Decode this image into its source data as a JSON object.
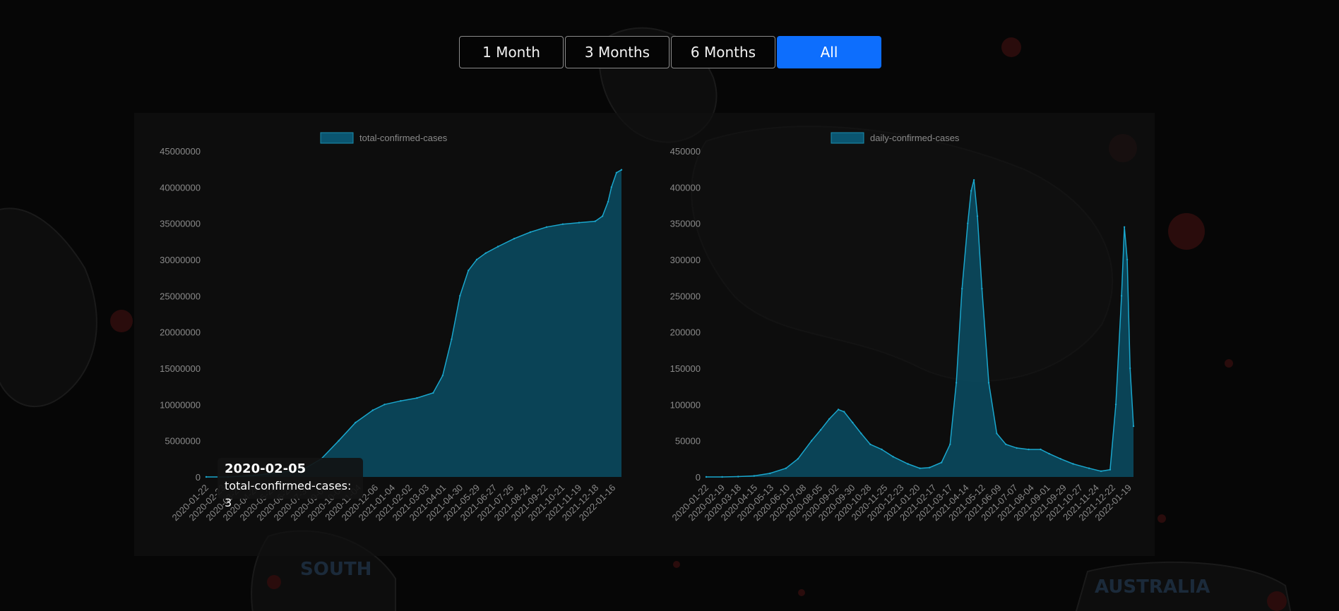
{
  "range_buttons": [
    {
      "label": "1 Month",
      "active": false
    },
    {
      "label": "3 Months",
      "active": false
    },
    {
      "label": "6 Months",
      "active": false
    },
    {
      "label": "All",
      "active": true
    }
  ],
  "colors": {
    "accent": "#0d6efd",
    "series_fill": "#0a4d64",
    "series_line": "#1aa6cc",
    "legend_box": "#0a5570"
  },
  "tooltip": {
    "title": "2020-02-05",
    "body": "total-confirmed-cases: 3"
  },
  "chart_data": [
    {
      "type": "area",
      "title": "",
      "series": [
        {
          "name": "total-confirmed-cases"
        }
      ],
      "legend": "top",
      "ylim": [
        0,
        45000000
      ],
      "ytick_labels": [
        "0",
        "5000000",
        "10000000",
        "15000000",
        "20000000",
        "25000000",
        "30000000",
        "35000000",
        "40000000",
        "45000000"
      ],
      "xtick_labels": [
        "2020-01-22",
        "2020-02-23",
        "2020-03-25",
        "2020-04-26",
        "2020-05-28",
        "2020-06-29",
        "2020-07-31",
        "2020-09-01",
        "2020-10-03",
        "2020-11-04",
        "2020-12-06",
        "2021-01-04",
        "2021-02-02",
        "2021-03-03",
        "2021-04-01",
        "2021-04-30",
        "2021-05-29",
        "2021-06-27",
        "2021-07-26",
        "2021-08-24",
        "2021-09-22",
        "2021-10-21",
        "2021-11-19",
        "2021-12-18",
        "2022-01-16"
      ],
      "x": [
        "2020-01-22",
        "2020-03-01",
        "2020-04-15",
        "2020-06-01",
        "2020-07-15",
        "2020-08-15",
        "2020-09-15",
        "2020-10-15",
        "2020-11-15",
        "2020-12-06",
        "2021-01-04",
        "2021-02-02",
        "2021-03-03",
        "2021-03-20",
        "2021-04-05",
        "2021-04-20",
        "2021-05-05",
        "2021-05-20",
        "2021-06-05",
        "2021-06-27",
        "2021-07-26",
        "2021-08-24",
        "2021-09-22",
        "2021-10-21",
        "2021-11-19",
        "2021-12-18",
        "2021-12-31",
        "2022-01-10",
        "2022-01-16",
        "2022-01-25",
        "2022-02-03"
      ],
      "values": [
        0,
        3000,
        200000,
        600000,
        1100000,
        2500000,
        5000000,
        7500000,
        9200000,
        10000000,
        10500000,
        10900000,
        11600000,
        14000000,
        19000000,
        25000000,
        28500000,
        30000000,
        30900000,
        31800000,
        32900000,
        33800000,
        34500000,
        34900000,
        35100000,
        35300000,
        36000000,
        38000000,
        40000000,
        42000000,
        42400000
      ]
    },
    {
      "type": "area",
      "title": "",
      "series": [
        {
          "name": "daily-confirmed-cases"
        }
      ],
      "legend": "top",
      "ylim": [
        0,
        450000
      ],
      "ytick_labels": [
        "0",
        "50000",
        "100000",
        "150000",
        "200000",
        "250000",
        "300000",
        "350000",
        "400000",
        "450000"
      ],
      "xtick_labels": [
        "2020-01-22",
        "2020-02-19",
        "2020-03-18",
        "2020-04-15",
        "2020-05-13",
        "2020-06-10",
        "2020-07-08",
        "2020-08-05",
        "2020-09-02",
        "2020-09-30",
        "2020-10-28",
        "2020-11-25",
        "2020-12-23",
        "2021-01-20",
        "2021-02-17",
        "2021-03-17",
        "2021-04-14",
        "2021-05-12",
        "2021-06-09",
        "2021-07-07",
        "2021-08-04",
        "2021-09-01",
        "2021-09-29",
        "2021-10-27",
        "2021-11-24",
        "2021-12-22",
        "2022-01-19"
      ],
      "x": [
        "2020-01-22",
        "2020-02-19",
        "2020-03-18",
        "2020-04-15",
        "2020-05-13",
        "2020-06-10",
        "2020-07-01",
        "2020-07-25",
        "2020-08-10",
        "2020-08-25",
        "2020-09-10",
        "2020-09-20",
        "2020-10-05",
        "2020-10-20",
        "2020-11-05",
        "2020-11-25",
        "2020-12-15",
        "2021-01-10",
        "2021-01-31",
        "2021-02-17",
        "2021-03-10",
        "2021-03-25",
        "2021-04-05",
        "2021-04-15",
        "2021-04-25",
        "2021-05-01",
        "2021-05-06",
        "2021-05-12",
        "2021-05-20",
        "2021-06-01",
        "2021-06-15",
        "2021-07-01",
        "2021-07-20",
        "2021-08-10",
        "2021-08-31",
        "2021-09-15",
        "2021-10-05",
        "2021-10-27",
        "2021-11-24",
        "2021-12-15",
        "2021-12-31",
        "2022-01-10",
        "2022-01-20",
        "2022-01-25",
        "2022-01-30",
        "2022-02-04",
        "2022-02-10"
      ],
      "values": [
        0,
        0,
        500,
        1500,
        5000,
        12000,
        25000,
        50000,
        65000,
        80000,
        93000,
        90000,
        75000,
        60000,
        45000,
        38000,
        28000,
        18000,
        12000,
        13000,
        20000,
        45000,
        130000,
        260000,
        350000,
        395000,
        410000,
        360000,
        260000,
        130000,
        60000,
        45000,
        40000,
        38000,
        38000,
        32000,
        25000,
        18000,
        12000,
        8000,
        10000,
        100000,
        250000,
        345000,
        300000,
        150000,
        70000
      ]
    }
  ]
}
